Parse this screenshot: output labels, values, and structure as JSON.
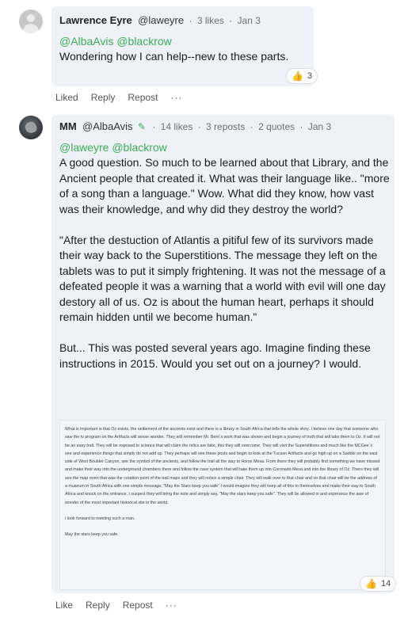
{
  "post1": {
    "author": "Lawrence Eyre",
    "handle": "@laweyre",
    "stats": [
      "3 likes",
      "Jan 3"
    ],
    "mentions": "@AlbaAvis @blackrow",
    "body": [
      "Wondering how I can help--new to these parts."
    ],
    "like_count": "3",
    "actions": {
      "like": "Liked",
      "reply": "Reply",
      "repost": "Repost",
      "more": "···"
    }
  },
  "post2": {
    "author": "MM",
    "handle": "@AlbaAvis",
    "stats": [
      "14 likes",
      "3 reposts",
      "2 quotes",
      "Jan 3"
    ],
    "mentions": "@laweyre @blackrow",
    "body": [
      "A good question. So much to be learned about that Library, and the Ancient people that created it. What was their language like.. \"more of a song than a language.\" Wow. What did they know, how vast was their knowledge, and why did they destroy the world?",
      "\"After the destuction of Atlantis a pitiful few of its survivors made their way back to the Superstitions. The message they left on the tablets was to put it simply frightening. It was not the message of a defeated people it was a warning that a world with evil will one day destory all of us. Oz is about the human heart, perhaps it should remain hidden until we become human.\"",
      "But... This was posted several years ago. Imagine finding these instructions in 2015. Would you set out on a journey? I would."
    ],
    "attachment": [
      "What is important is that Oz exists, the settlement of the ancients exist and there is a library in South Africa that tells the whole story. I believe one day that someone who saw the tv program on the Artifacts will sense wonder. They will remember Mr. Bent`s work that was shown and begin a journey of truth that will take them to Oz. It will not be an easy trail. They will be exposed to science that will claim the relics are fake, this they will overcome. They will visit the Superstitions and much like the MCGee`s see and experience things that simply do not add up. They perhaps will see these posts and begin to look at the Tucson Artifacts and go high up on a Saddle on the east side of West Boulder Canyon, see the symbol of the ancients, and follow the trail all the way to Horse Mesa. From there they will probably find something we have missed and make their way into the underground chambers there and follow the cave system that will take them up into Coronado Mesa and into the library of Oz. There they will see the map room that was the creation point of the trail maps and they will notice a simple chair. They will walk over to that chair and on that chair will be the address of a museum in South Africa with one simple message, \"May the Stars keep you safe\" I would imagine they will keep all of this to themselves and make their way to South Africa and knock on the entrance. I suspect they will bring the note and simply say, \"May the stars keep you safe\". They will be allowed in and experance the awe of wonder of the most important historical site in the world.",
      "I look forward to meeting such a man.",
      "May the stars keep you safe."
    ],
    "like_count": "14",
    "actions": {
      "like": "Like",
      "reply": "Reply",
      "repost": "Repost",
      "more": "···"
    }
  },
  "icons": {
    "thumb": "thumbs-up-icon",
    "pencil": "pencil-icon",
    "more": "more-icon"
  },
  "colors": {
    "mention": "#3dab55",
    "bubble": "#eef2f8",
    "thumb": "#e2a128"
  }
}
